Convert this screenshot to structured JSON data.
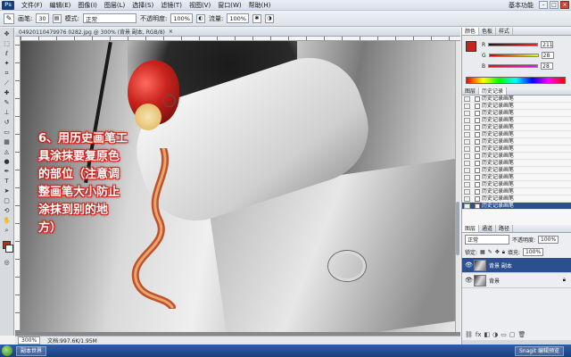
{
  "menubar": {
    "logo": "Ps",
    "items": [
      "文件(F)",
      "编辑(E)",
      "图像(I)",
      "图层(L)",
      "选择(S)",
      "滤镜(T)",
      "视图(V)",
      "窗口(W)",
      "帮助(H)"
    ],
    "workspace": "基本功能"
  },
  "options": {
    "brush_label": "画笔:",
    "brush_size": "30",
    "mode_label": "模式:",
    "mode_value": "正常",
    "opacity_label": "不透明度:",
    "opacity_value": "100%",
    "flow_label": "流量:",
    "flow_value": "100%"
  },
  "document": {
    "tab_title": "04920110479976 0282.jpg @ 300% (背景 副本, RGB/8)",
    "tab_close": "×",
    "annotation": "6、用历史画笔工\n具涂抹要复原色\n的部位（注意调\n整画笔大小防止\n涂抹到别的地\n方）"
  },
  "status": {
    "zoom": "300%",
    "doc_info": "文档:997.6K/1.95M"
  },
  "panels": {
    "color_tabs": [
      "颜色",
      "色板",
      "样式"
    ],
    "color_values": {
      "r_label": "R",
      "r": "211",
      "g_label": "G",
      "g": "28",
      "b_label": "B",
      "b": "28"
    },
    "history_tabs": [
      "图层",
      "历史记录"
    ],
    "history_items": [
      "历史记录画笔",
      "历史记录画笔",
      "历史记录画笔",
      "历史记录画笔",
      "历史记录画笔",
      "历史记录画笔",
      "历史记录画笔",
      "历史记录画笔",
      "历史记录画笔",
      "历史记录画笔",
      "历史记录画笔",
      "历史记录画笔",
      "历史记录画笔",
      "历史记录画笔",
      "历史记录画笔",
      "历史记录画笔"
    ],
    "layers_tabs": [
      "图层",
      "通道",
      "路径"
    ],
    "blend_mode": "正常",
    "opacity_label": "不透明度:",
    "opacity_value": "100%",
    "lock_label": "锁定:",
    "fill_label": "填充:",
    "fill_value": "100%",
    "layers": [
      "背景 副本",
      "背景"
    ]
  },
  "taskbar": {
    "items": [
      "副本世界",
      "Snagit 编辑预览"
    ],
    "clock": ""
  },
  "colors": {
    "foreground": "#c8231d",
    "selection": "#2c4f8f"
  }
}
